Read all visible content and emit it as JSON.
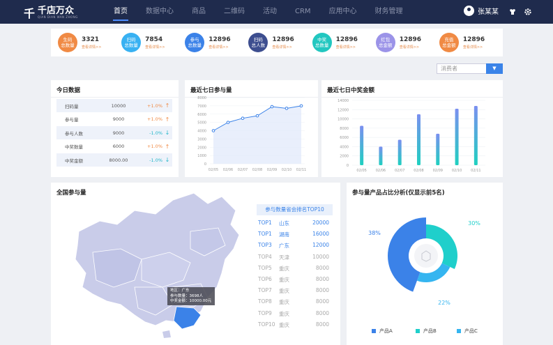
{
  "app": {
    "logo_mark": "千",
    "logo_text": "千店万众",
    "logo_sub": "QIAN DIAN WAN ZHONG"
  },
  "nav": [
    "首页",
    "数据中心",
    "商品",
    "二维码",
    "活动",
    "CRM",
    "应用中心",
    "财务管理"
  ],
  "user": {
    "name": "张某某"
  },
  "stats": [
    {
      "label1": "生码",
      "label2": "总数量",
      "value": "3321",
      "link": "查看详情>>",
      "color": "#f08a44"
    },
    {
      "label1": "扫码",
      "label2": "总数量",
      "value": "7854",
      "link": "查看详情>>",
      "color": "#38b1f2"
    },
    {
      "label1": "参与",
      "label2": "总数量",
      "value": "12896",
      "link": "查看详情>>",
      "color": "#3b82e8"
    },
    {
      "label1": "扫码",
      "label2": "总人数",
      "value": "12896",
      "link": "查看详情>>",
      "color": "#3d4e8f"
    },
    {
      "label1": "中奖",
      "label2": "总数量",
      "value": "12896",
      "link": "查看详情>>",
      "color": "#22c7c0"
    },
    {
      "label1": "红包",
      "label2": "总金额",
      "value": "12896",
      "link": "查看详情>>",
      "color": "#9b93e8"
    },
    {
      "label1": "充值",
      "label2": "总金额",
      "value": "12896",
      "link": "查看详情>>",
      "color": "#f08a44"
    }
  ],
  "filter": {
    "value": "消费者"
  },
  "today": {
    "title": "今日数据",
    "rows": [
      {
        "name": "扫码量",
        "value": "10000",
        "pct": "+1.0%",
        "dir": "up"
      },
      {
        "name": "参与量",
        "value": "9000",
        "pct": "+1.0%",
        "dir": "up"
      },
      {
        "name": "参与人数",
        "value": "9000",
        "pct": "-1.0%",
        "dir": "down"
      },
      {
        "name": "中奖数量",
        "value": "6000",
        "pct": "+1.0%",
        "dir": "up"
      },
      {
        "name": "中奖金额",
        "value": "8000.00",
        "pct": "-1.0%",
        "dir": "down"
      }
    ],
    "colors": {
      "up": "#f08a44",
      "down": "#22b6c9"
    }
  },
  "line_card": {
    "title": "最近七日参与量"
  },
  "bar_card": {
    "title": "最近七日中奖金额"
  },
  "map_card": {
    "title": "全国参与量",
    "rank_title": "参与数量省会排名TOP10",
    "ranks": [
      {
        "rank": "TOP1",
        "province": "山东",
        "value": "20000"
      },
      {
        "rank": "TOP1",
        "province": "湖南",
        "value": "16000"
      },
      {
        "rank": "TOP3",
        "province": "广东",
        "value": "12000"
      },
      {
        "rank": "TOP4",
        "province": "天津",
        "value": "10000"
      },
      {
        "rank": "TOP5",
        "province": "重庆",
        "value": "8000"
      },
      {
        "rank": "TOP6",
        "province": "重庆",
        "value": "8000"
      },
      {
        "rank": "TOP7",
        "province": "重庆",
        "value": "8000"
      },
      {
        "rank": "TOP8",
        "province": "重庆",
        "value": "8000"
      },
      {
        "rank": "TOP9",
        "province": "重庆",
        "value": "8000"
      },
      {
        "rank": "TOP10",
        "province": "重庆",
        "value": "8000"
      }
    ],
    "tooltip": {
      "line1": "地区：广东",
      "line2": "参与数量：3698人",
      "line3": "中奖金额：10000.00元"
    }
  },
  "donut_card": {
    "title": "参与量产品占比分析(仅显示前5名)"
  },
  "chart_data": [
    {
      "type": "line",
      "categories": [
        "02/05",
        "02/06",
        "02/07",
        "02/08",
        "02/09",
        "02/10",
        "02/11"
      ],
      "values": [
        4000,
        5000,
        5500,
        5800,
        6900,
        6700,
        7000
      ],
      "ylim": [
        0,
        8000
      ],
      "yticks": [
        "0",
        "1000",
        "2000",
        "3000",
        "4000",
        "5000",
        "6000",
        "7000",
        "8000"
      ],
      "color": "#3b82e8"
    },
    {
      "type": "bar",
      "categories": [
        "02/05",
        "02/06",
        "02/07",
        "02/08",
        "02/09",
        "02/10",
        "02/11"
      ],
      "values": [
        8500,
        4000,
        5500,
        11000,
        6800,
        12200,
        12800
      ],
      "ylim": [
        0,
        14000
      ],
      "yticks": [
        "0",
        "2000",
        "4000",
        "6000",
        "8000",
        "10000",
        "12000",
        "14000"
      ],
      "colors": [
        "#7b8ff0",
        "#1fd0c0"
      ]
    },
    {
      "type": "pie",
      "labels": [
        "产品A",
        "产品B",
        "产品C"
      ],
      "values": [
        38,
        30,
        22
      ],
      "percent_labels": [
        "38%",
        "30%",
        "22%"
      ],
      "colors": [
        "#3b82e8",
        "#1fcfcb",
        "#35b5f0"
      ]
    }
  ]
}
